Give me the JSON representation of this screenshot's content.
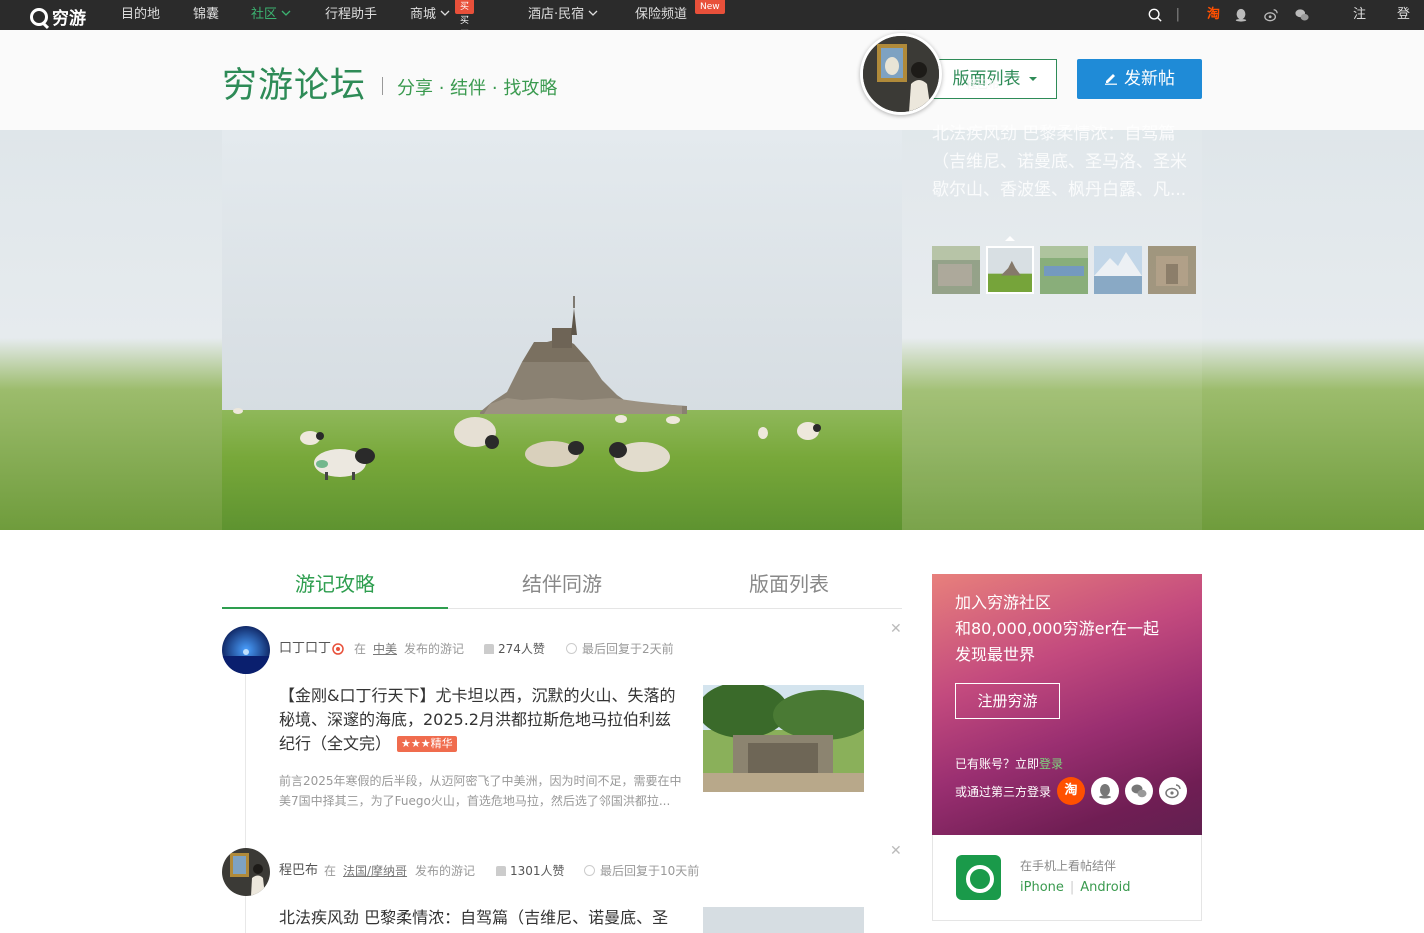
{
  "nav": {
    "logo": "穷游",
    "items": [
      {
        "label": "目的地"
      },
      {
        "label": "锦囊"
      },
      {
        "label": "社区"
      },
      {
        "label": "行程助手"
      },
      {
        "label": "商城"
      },
      {
        "label": "酒店·民宿"
      },
      {
        "label": "保险频道"
      }
    ],
    "badges": {
      "mall": "买买买",
      "insurance": "New"
    },
    "right": {
      "taobao": "淘",
      "register": "注册",
      "login": "登录"
    }
  },
  "header": {
    "title": "穷游论坛",
    "subtitle": "分享 · 结伴 · 找攻略",
    "board_list_button": "版面列表",
    "new_post_button": "发新帖"
  },
  "hero": {
    "author": "程巴布",
    "post_title": "北法疾风劲 巴黎柔情浓：自驾篇（吉维尼、诺曼底、圣马洛、圣米歇尔山、香波堡、枫丹白露、凡..."
  },
  "tabs": [
    {
      "label": "游记攻略",
      "active": true
    },
    {
      "label": "结伴同游",
      "active": false
    },
    {
      "label": "版面列表",
      "active": false
    }
  ],
  "posts": [
    {
      "author": "口丁口丁",
      "in": "在",
      "location": "中美",
      "action": "发布的游记",
      "likes": "274人赞",
      "last_reply": "最后回复于2天前",
      "title": "【金刚&口丁行天下】尤卡坦以西，沉默的火山、失落的秘境、深邃的海底，2025.2月洪都拉斯危地马拉伯利兹纪行（全文完）",
      "tag": "★★★精华",
      "excerpt": "前言2025年寒假的后半段，从迈阿密飞了中美洲，因为时间不足，需要在中美7国中择其三，为了Fuego火山，首选危地马拉，然后选了邻国洪都拉..."
    },
    {
      "author": "程巴布",
      "in": "在",
      "location": "法国/摩纳哥",
      "action": "发布的游记",
      "likes": "1301人赞",
      "last_reply": "最后回复于10天前",
      "title": "北法疾风劲 巴黎柔情浓：自驾篇（吉维尼、诺曼底、圣"
    }
  ],
  "join": {
    "line1": "加入穷游社区",
    "line2": "和80,000,000穷游er在一起",
    "line3": "发现最世界",
    "button": "注册穷游",
    "have_account": "已有账号？立即",
    "login_link": "登录",
    "third_party": "或通过第三方登录",
    "social_taobao": "淘"
  },
  "app": {
    "text": "在手机上看帖结伴",
    "iphone": "iPhone",
    "android": "Android"
  },
  "colors": {
    "brand_green": "#2e8b57",
    "post_blue": "#1f8bd7",
    "nav_bg": "#2b2b2b",
    "badge_red": "#e8503a"
  }
}
